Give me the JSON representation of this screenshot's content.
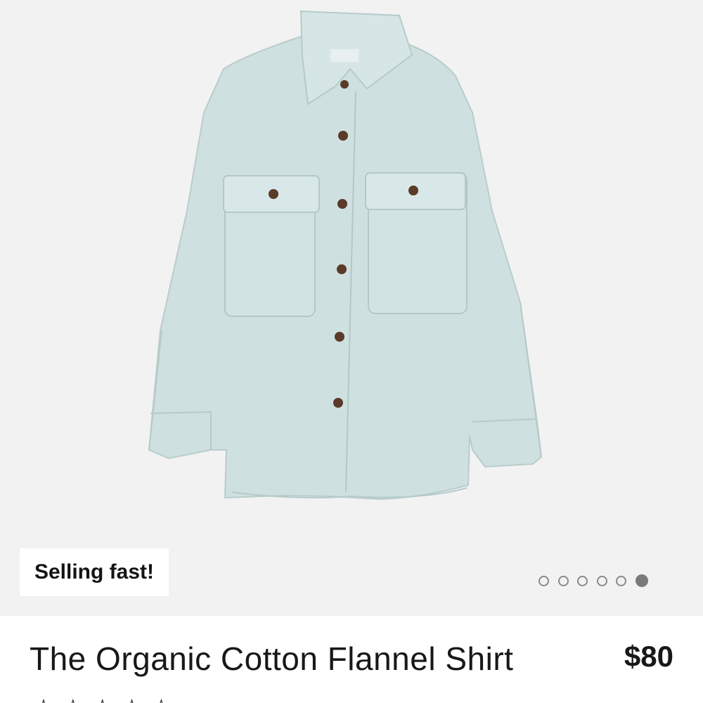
{
  "gallery": {
    "image_alt": "The Organic Cotton Flannel Shirt",
    "badge": "Selling fast!",
    "dots_count": 6,
    "active_dot_index": 5,
    "background": "#f2f2f2",
    "shirt_color": "#cfe0e0",
    "button_color": "#5a3a28"
  },
  "product": {
    "title": "The Organic Cotton Flannel Shirt",
    "price": "$80",
    "rating_stars": 5
  }
}
